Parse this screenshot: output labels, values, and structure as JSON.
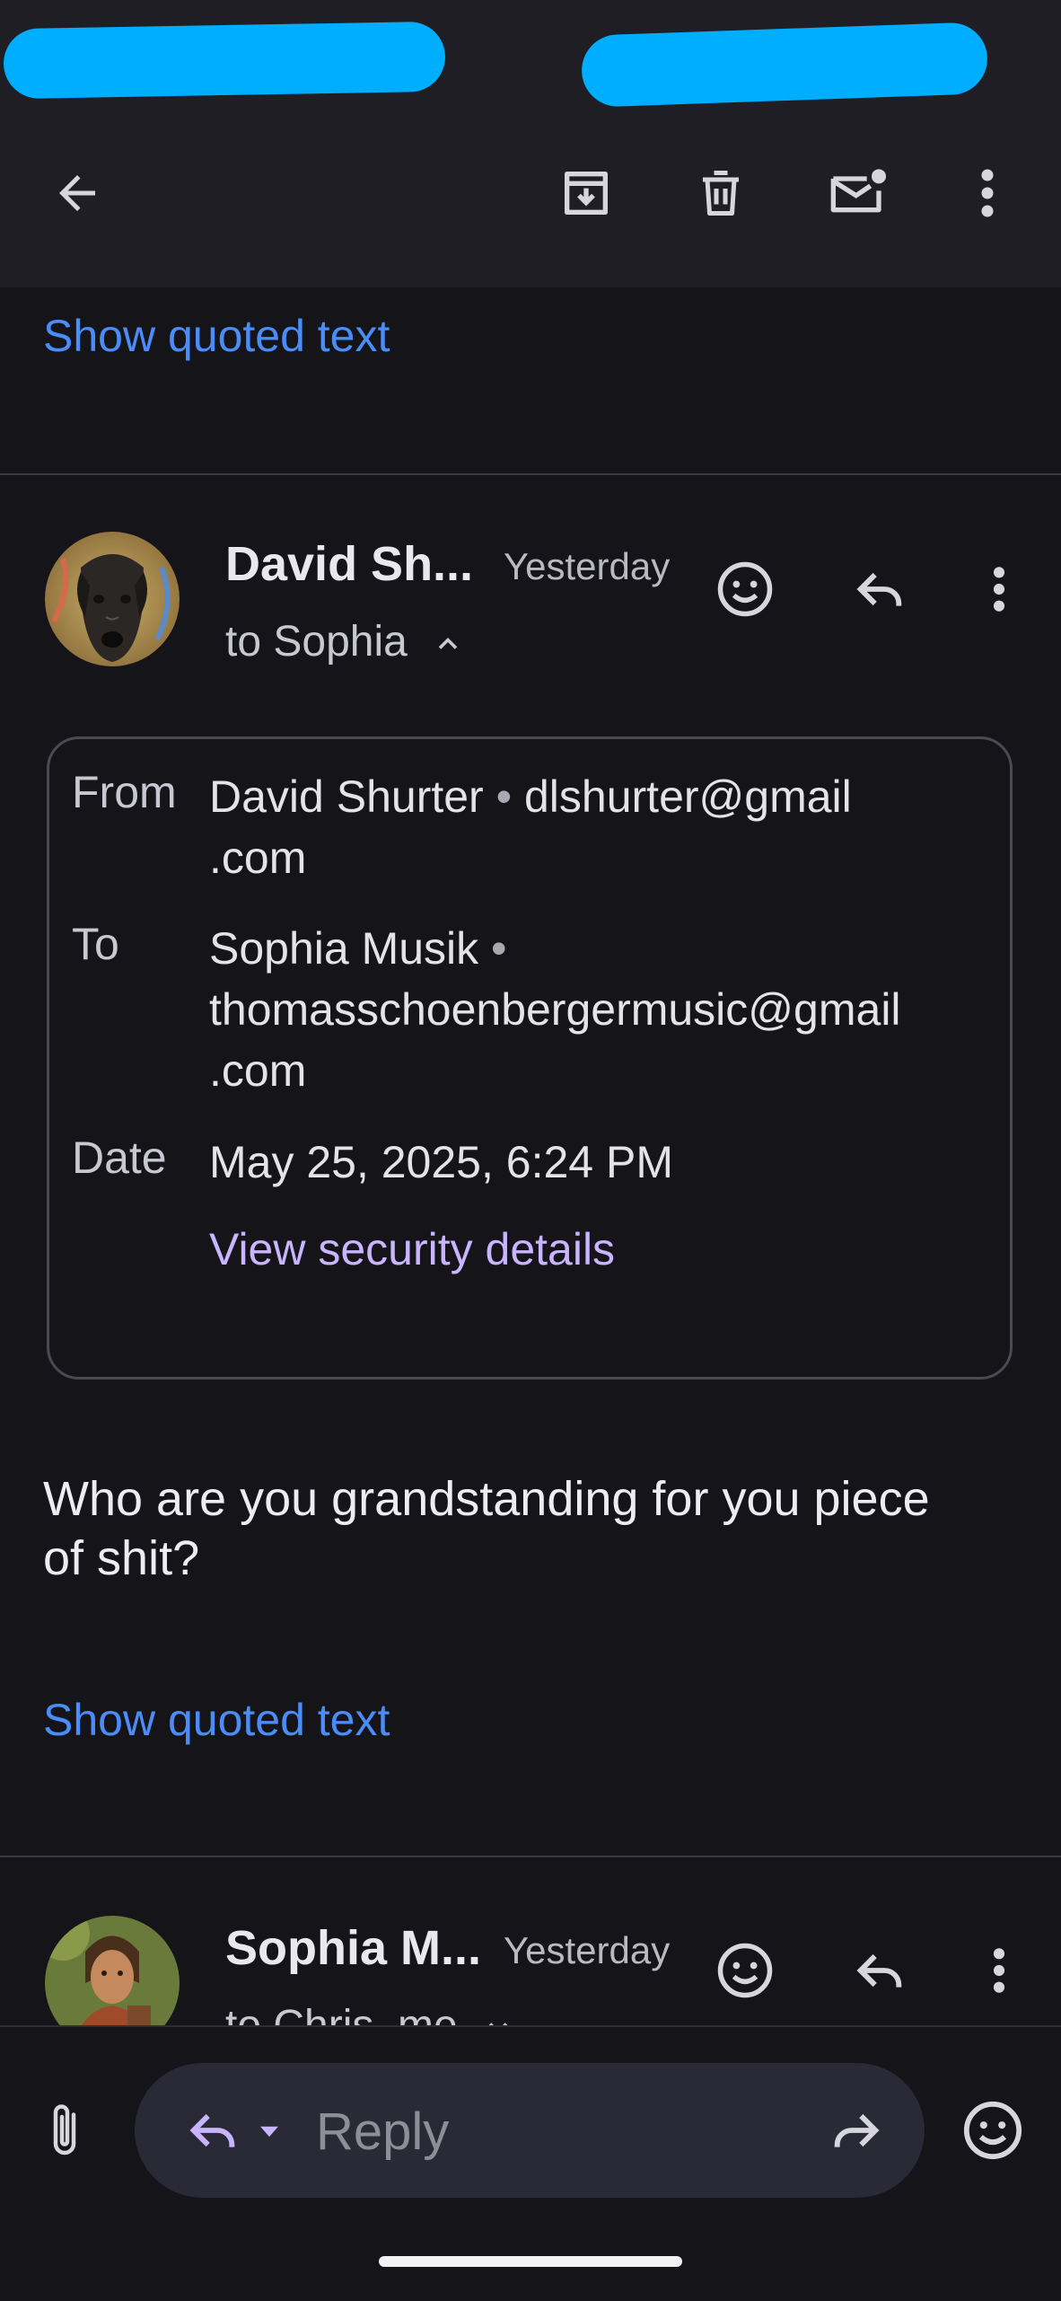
{
  "toolbar": {
    "back_icon": "arrow-left-icon",
    "archive_icon": "archive-icon",
    "delete_icon": "trash-icon",
    "mark_unread_icon": "mark-unread-icon",
    "more_icon": "more-vert-icon"
  },
  "thread": {
    "show_quoted_top": "Show quoted text",
    "messages": [
      {
        "sender_short": "David Sh...",
        "time": "Yesterday",
        "to_line": "to Sophia",
        "details": {
          "from_label": "From",
          "from_name": "David Shurter",
          "from_email_line1": "dlshurter@gmail",
          "from_email_line2": ".com",
          "to_label": "To",
          "to_name": "Sophia Musik",
          "to_email_line1": "thomasschoenbergermusic@gmail",
          "to_email_line2": ".com",
          "date_label": "Date",
          "date_value": "May 25, 2025, 6:24 PM",
          "security_link": "View security details"
        },
        "body_line1": "Who are you grandstanding for you piece",
        "body_line2": "of shit?",
        "show_quoted": "Show quoted text"
      },
      {
        "sender_short": "Sophia M...",
        "time": "Yesterday",
        "to_line": "to Chris, me"
      }
    ]
  },
  "composer": {
    "reply_placeholder": "Reply"
  },
  "colors": {
    "background": "#141419",
    "link": "#4b8df8",
    "security_link": "#c9b4ff",
    "redaction": "#00aeff"
  }
}
